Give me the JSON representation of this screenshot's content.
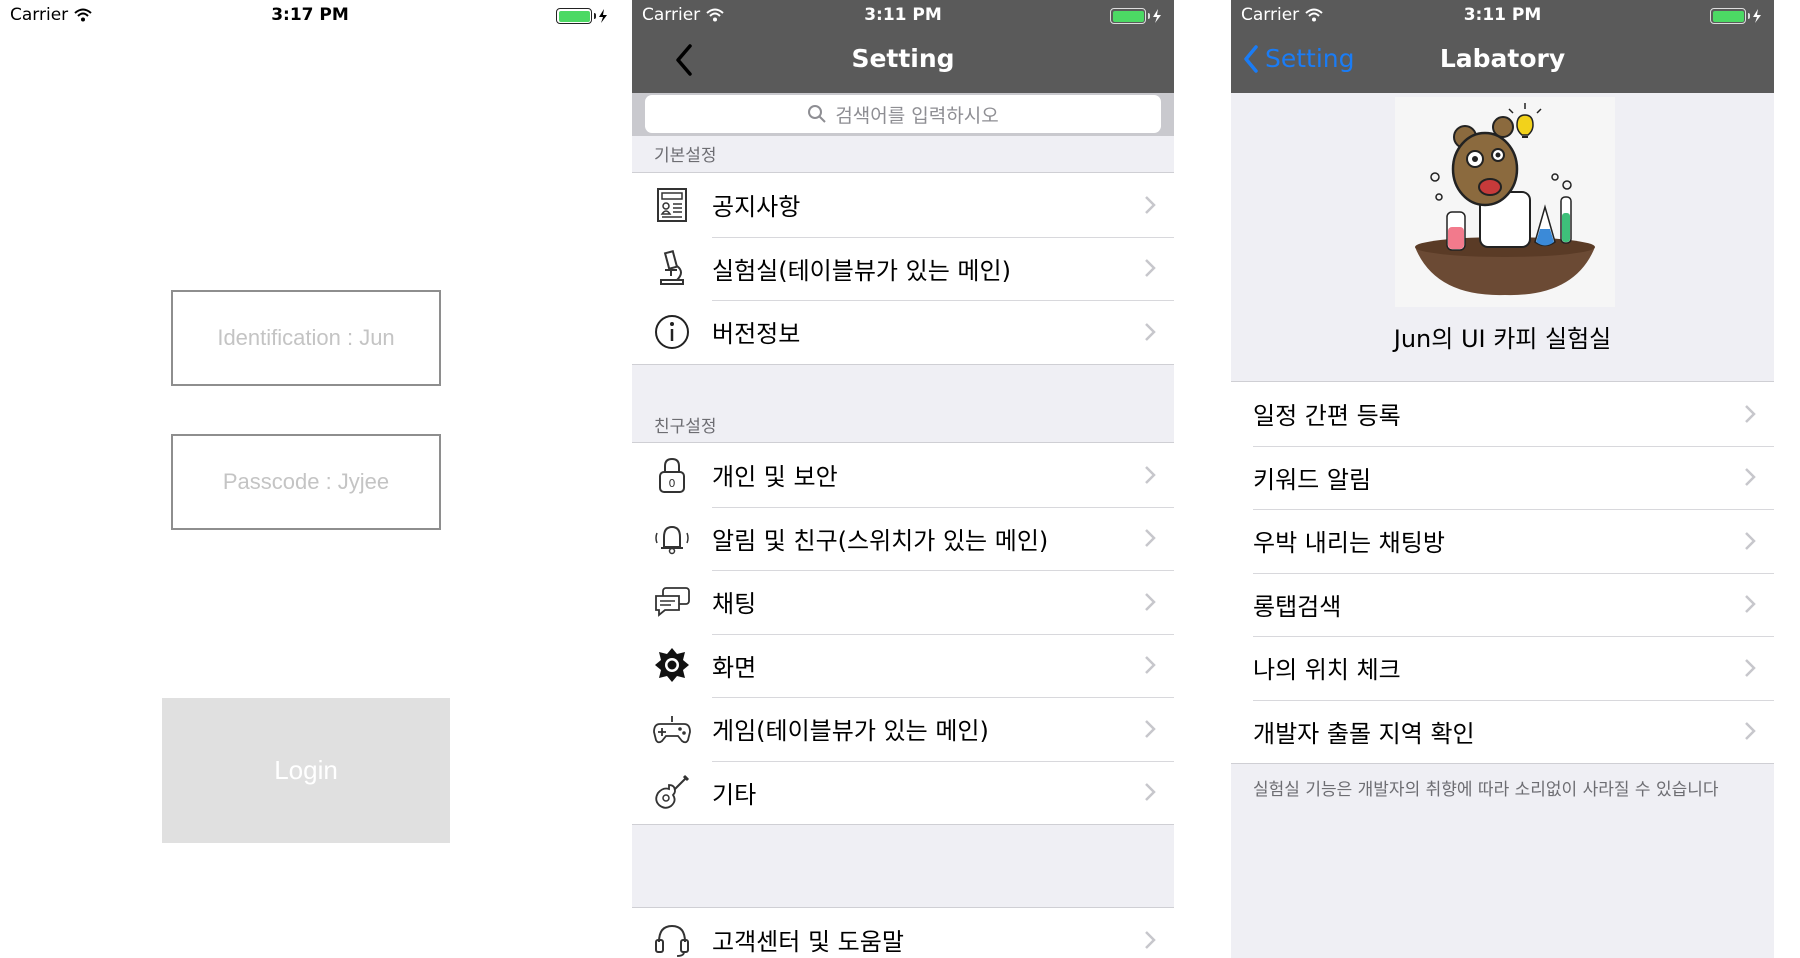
{
  "login_screen": {
    "status": {
      "carrier": "Carrier",
      "time": "3:17 PM"
    },
    "id_placeholder": "Identification : Jun",
    "passcode_placeholder": "Passcode : Jyjee",
    "login_label": "Login"
  },
  "setting_screen": {
    "status": {
      "carrier": "Carrier",
      "time": "3:11 PM"
    },
    "title": "Setting",
    "search_placeholder": "검색어를 입력하시오",
    "sections": [
      {
        "header": "기본설정",
        "items": [
          {
            "label": "공지사항",
            "icon": "news-icon"
          },
          {
            "label": "실험실(테이블뷰가 있는 메인)",
            "icon": "microscope-icon"
          },
          {
            "label": "버전정보",
            "icon": "info-icon"
          }
        ]
      },
      {
        "header": "친구설정",
        "items": [
          {
            "label": "개인 및 보안",
            "icon": "lock-icon"
          },
          {
            "label": "알림 및 친구(스위치가 있는 메인)",
            "icon": "bell-icon"
          },
          {
            "label": "채팅",
            "icon": "chat-icon"
          },
          {
            "label": "화면",
            "icon": "brightness-icon"
          },
          {
            "label": "게임(테이블뷰가 있는 메인)",
            "icon": "gamepad-icon"
          },
          {
            "label": "기타",
            "icon": "guitar-icon"
          }
        ]
      },
      {
        "header": "",
        "items": [
          {
            "label": "고객센터 및 도움말",
            "icon": "headset-icon"
          }
        ]
      }
    ]
  },
  "lab_screen": {
    "status": {
      "carrier": "Carrier",
      "time": "3:11 PM"
    },
    "back_label": "Setting",
    "title": "Labatory",
    "header_title": "Jun의 UI 카피 실험실",
    "items": [
      {
        "label": "일정 간편 등록"
      },
      {
        "label": "키워드 알림"
      },
      {
        "label": "우박 내리는 채팅방"
      },
      {
        "label": "롱탭검색"
      },
      {
        "label": "나의 위치 체크"
      },
      {
        "label": "개발자 출몰 지역 확인"
      }
    ],
    "footer": "실험실 기능은 개발자의 취향에 따라 소리없이 사라질 수 있습니다"
  },
  "colors": {
    "nav_bar": "#5a5a5a",
    "background": "#efeff4",
    "ios_blue": "#1a7cf5",
    "battery": "#4cd964",
    "login_button": "#e0e0e0"
  }
}
